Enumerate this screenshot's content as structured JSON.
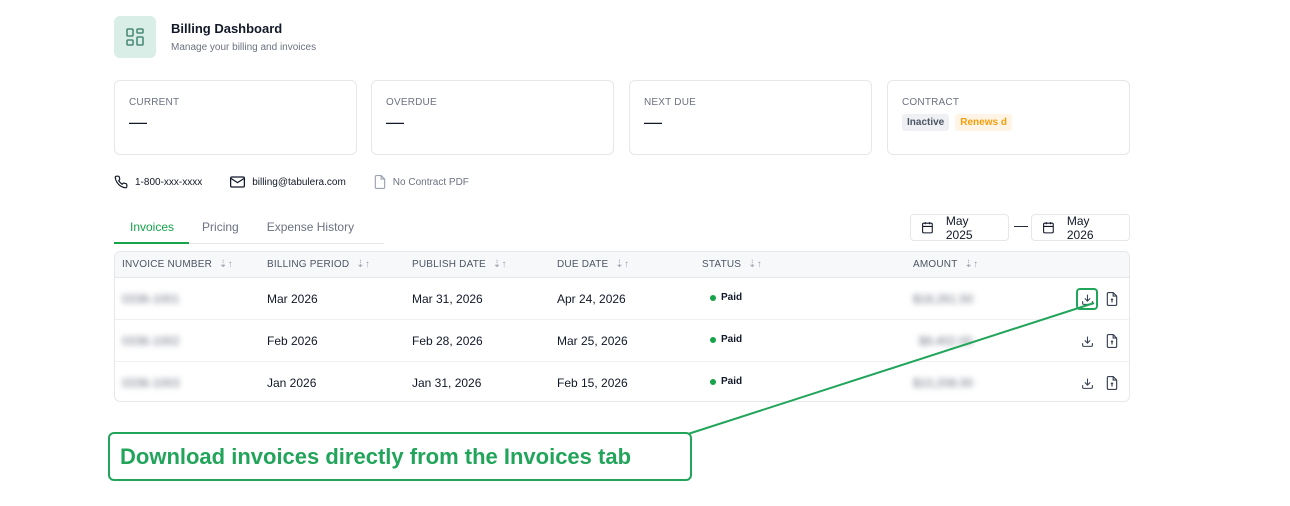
{
  "header": {
    "title": "Billing Dashboard",
    "subtitle": "Manage your billing and invoices",
    "icon": "dashboard-grid-icon"
  },
  "cards": [
    {
      "label": "CURRENT",
      "value": "—"
    },
    {
      "label": "OVERDUE",
      "value": "—"
    },
    {
      "label": "NEXT DUE",
      "value": "—"
    },
    {
      "label": "CONTRACT",
      "pills": [
        "Inactive",
        "Renews d"
      ]
    }
  ],
  "contacts": {
    "phone": "1-800-xxx-xxxx",
    "email": "billing@tabulera.com",
    "pdf": "No Contract PDF"
  },
  "tabs": [
    "Invoices",
    "Pricing",
    "Expense History"
  ],
  "active_tab": "Invoices",
  "date_range": {
    "from": "May 2025",
    "separator": "—",
    "to": "May 2026"
  },
  "table": {
    "headers": [
      "INVOICE NUMBER",
      "BILLING PERIOD",
      "PUBLISH DATE",
      "DUE DATE",
      "STATUS",
      "AMOUNT"
    ],
    "sort_icon": "⇣↑",
    "rows": [
      {
        "invoice": "0336-1001",
        "period": "Mar 2026",
        "publish": "Mar 31, 2026",
        "due": "Apr 24, 2026",
        "status": "Paid",
        "amount": "$18,261.50"
      },
      {
        "invoice": "0336-1002",
        "period": "Feb 2026",
        "publish": "Feb 28, 2026",
        "due": "Mar 25, 2026",
        "status": "Paid",
        "amount": "$9,402.00"
      },
      {
        "invoice": "0336-1003",
        "period": "Jan 2026",
        "publish": "Jan 31, 2026",
        "due": "Feb 15, 2026",
        "status": "Paid",
        "amount": "$10,208.00"
      }
    ]
  },
  "callout": {
    "text": "Download invoices directly from the Invoices tab"
  },
  "colors": {
    "accent": "#22a55b",
    "paid": "#16a34a",
    "renews": "#f59e0b"
  }
}
